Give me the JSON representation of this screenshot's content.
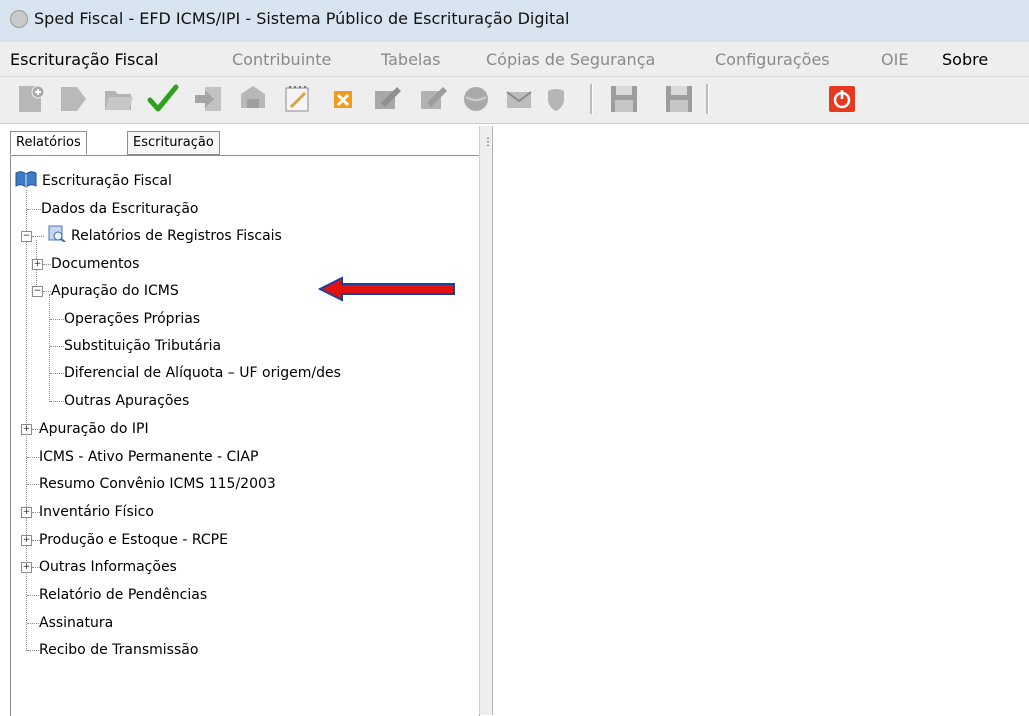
{
  "window": {
    "title": "Sped Fiscal - EFD ICMS/IPI - Sistema Público de Escrituração Digital"
  },
  "menu": [
    {
      "label": "Escrituração Fiscal",
      "enabled": true
    },
    {
      "label": "Contribuinte",
      "enabled": false
    },
    {
      "label": "Tabelas",
      "enabled": false
    },
    {
      "label": "Cópias de Segurança",
      "enabled": false
    },
    {
      "label": "Configurações",
      "enabled": false
    },
    {
      "label": "OIE",
      "enabled": false
    },
    {
      "label": "Sobre",
      "enabled": true
    }
  ],
  "toolbar": {
    "buttons": [
      "new-document-icon",
      "open-icon",
      "folder-icon",
      "validate-check-icon",
      "import-icon",
      "package-icon",
      "notepad-icon",
      "close-x-icon",
      "sign-icon",
      "sign-disabled-icon",
      "globe-icon",
      "mail-icon",
      "shield-icon",
      "save-icon",
      "save-as-icon",
      "power-exit-icon"
    ]
  },
  "tabs": [
    {
      "label": "Relatórios",
      "active": true
    },
    {
      "label": "Escrituração",
      "active": false
    }
  ],
  "tree": {
    "root": "Escrituração Fiscal",
    "items": [
      {
        "label": "Dados da Escrituração"
      },
      {
        "label": "Relatórios de Registros Fiscais",
        "expanded": true
      },
      {
        "label": "Documentos",
        "expanded": false
      },
      {
        "label": "Apuração do ICMS",
        "expanded": true
      },
      {
        "label": "Operações Próprias"
      },
      {
        "label": "Substituição Tributária"
      },
      {
        "label": "Diferencial de Alíquota – UF origem/des"
      },
      {
        "label": "Outras Apurações"
      },
      {
        "label": "Apuração do IPI",
        "expanded": false
      },
      {
        "label": "ICMS - Ativo Permanente - CIAP"
      },
      {
        "label": "Resumo  Convênio ICMS 115/2003"
      },
      {
        "label": "Inventário Físico",
        "expanded": false
      },
      {
        "label": "Produção e Estoque - RCPE",
        "expanded": false
      },
      {
        "label": "Outras Informações",
        "expanded": false
      },
      {
        "label": "Relatório de Pendências"
      },
      {
        "label": "Assinatura"
      },
      {
        "label": "Recibo de Transmissão"
      }
    ]
  },
  "annotation": {
    "arrow_color": "#e0120f",
    "arrow_border": "#1a3f9c"
  }
}
